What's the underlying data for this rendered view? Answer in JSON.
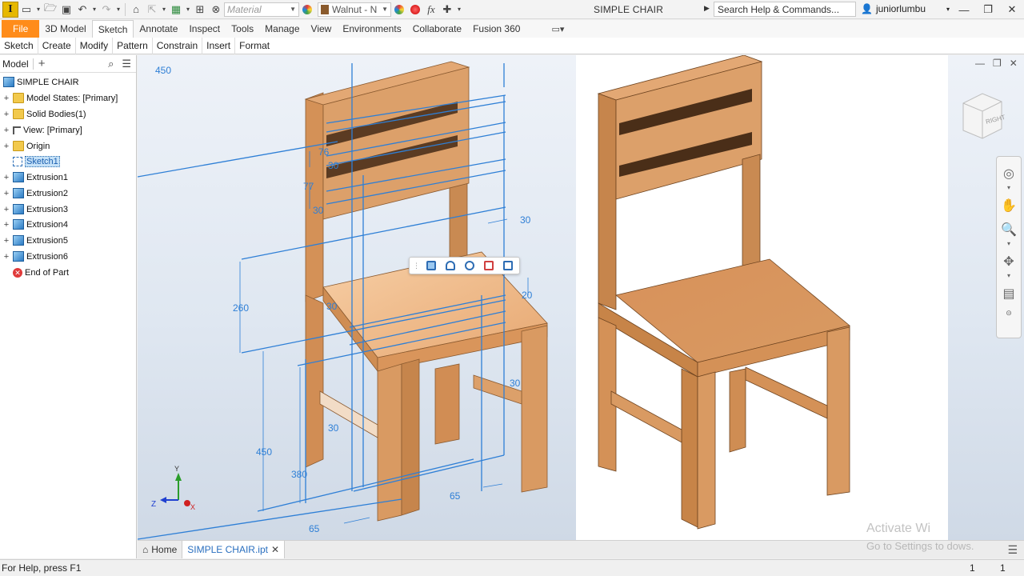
{
  "titlebar": {
    "app_letter": "I",
    "material_placeholder": "Material",
    "appearance_value": "Walnut - N",
    "doc_title": "SIMPLE CHAIR",
    "search_placeholder": "Search Help & Commands...",
    "username": "juniorlumbu",
    "fx_label": "fx"
  },
  "ribbon_tabs": [
    {
      "label": "File"
    },
    {
      "label": "3D Model"
    },
    {
      "label": "Sketch"
    },
    {
      "label": "Annotate"
    },
    {
      "label": "Inspect"
    },
    {
      "label": "Tools"
    },
    {
      "label": "Manage"
    },
    {
      "label": "View"
    },
    {
      "label": "Environments"
    },
    {
      "label": "Collaborate"
    },
    {
      "label": "Fusion 360"
    }
  ],
  "ribbon_panels": [
    "Sketch",
    "Create",
    "Modify",
    "Pattern",
    "Constrain",
    "Insert",
    "Format"
  ],
  "browser": {
    "tab_label": "Model",
    "items": [
      {
        "label": "SIMPLE CHAIR",
        "icon": "part-icon"
      },
      {
        "label": "Model States: [Primary]",
        "icon": "folder-icon"
      },
      {
        "label": "Solid Bodies(1)",
        "icon": "folder-icon"
      },
      {
        "label": "View: [Primary]",
        "icon": "view-icon"
      },
      {
        "label": "Origin",
        "icon": "folder-icon"
      },
      {
        "label": "Sketch1",
        "icon": "sketch-icon"
      },
      {
        "label": "Extrusion1",
        "icon": "extrusion-icon"
      },
      {
        "label": "Extrusion2",
        "icon": "extrusion-icon"
      },
      {
        "label": "Extrusion3",
        "icon": "extrusion-icon"
      },
      {
        "label": "Extrusion4",
        "icon": "extrusion-icon"
      },
      {
        "label": "Extrusion5",
        "icon": "extrusion-icon"
      },
      {
        "label": "Extrusion6",
        "icon": "extrusion-icon"
      },
      {
        "label": "End of Part",
        "icon": "end-of-part-icon"
      }
    ]
  },
  "dimensions": {
    "d450_top": "450",
    "d76": "76",
    "d30_a": "30",
    "d77": "77",
    "d30_b": "30",
    "d30_right": "30",
    "d260": "260",
    "d30_seat": "30",
    "d20": "20",
    "d30_lower": "30",
    "d30_rail": "30",
    "d450_left": "450",
    "d380": "380",
    "d65_bottom": "65",
    "d65_right": "65"
  },
  "viewcube_label": "RIGHT",
  "axis_labels": {
    "y": "Y",
    "z": "Z",
    "x": "X"
  },
  "doc_tabs": {
    "home": "Home",
    "active": "SIMPLE CHAIR.ipt"
  },
  "status": {
    "help_text": "For Help, press F1",
    "count1": "1",
    "count2": "1"
  },
  "watermark": {
    "line1": "Activate Wi",
    "line2": "Go to Settings to",
    "line3": "dows."
  },
  "colors": {
    "sketch_blue": "#2e7fd6",
    "wood": "#d99a62",
    "file_tab": "#ff8c1a"
  }
}
